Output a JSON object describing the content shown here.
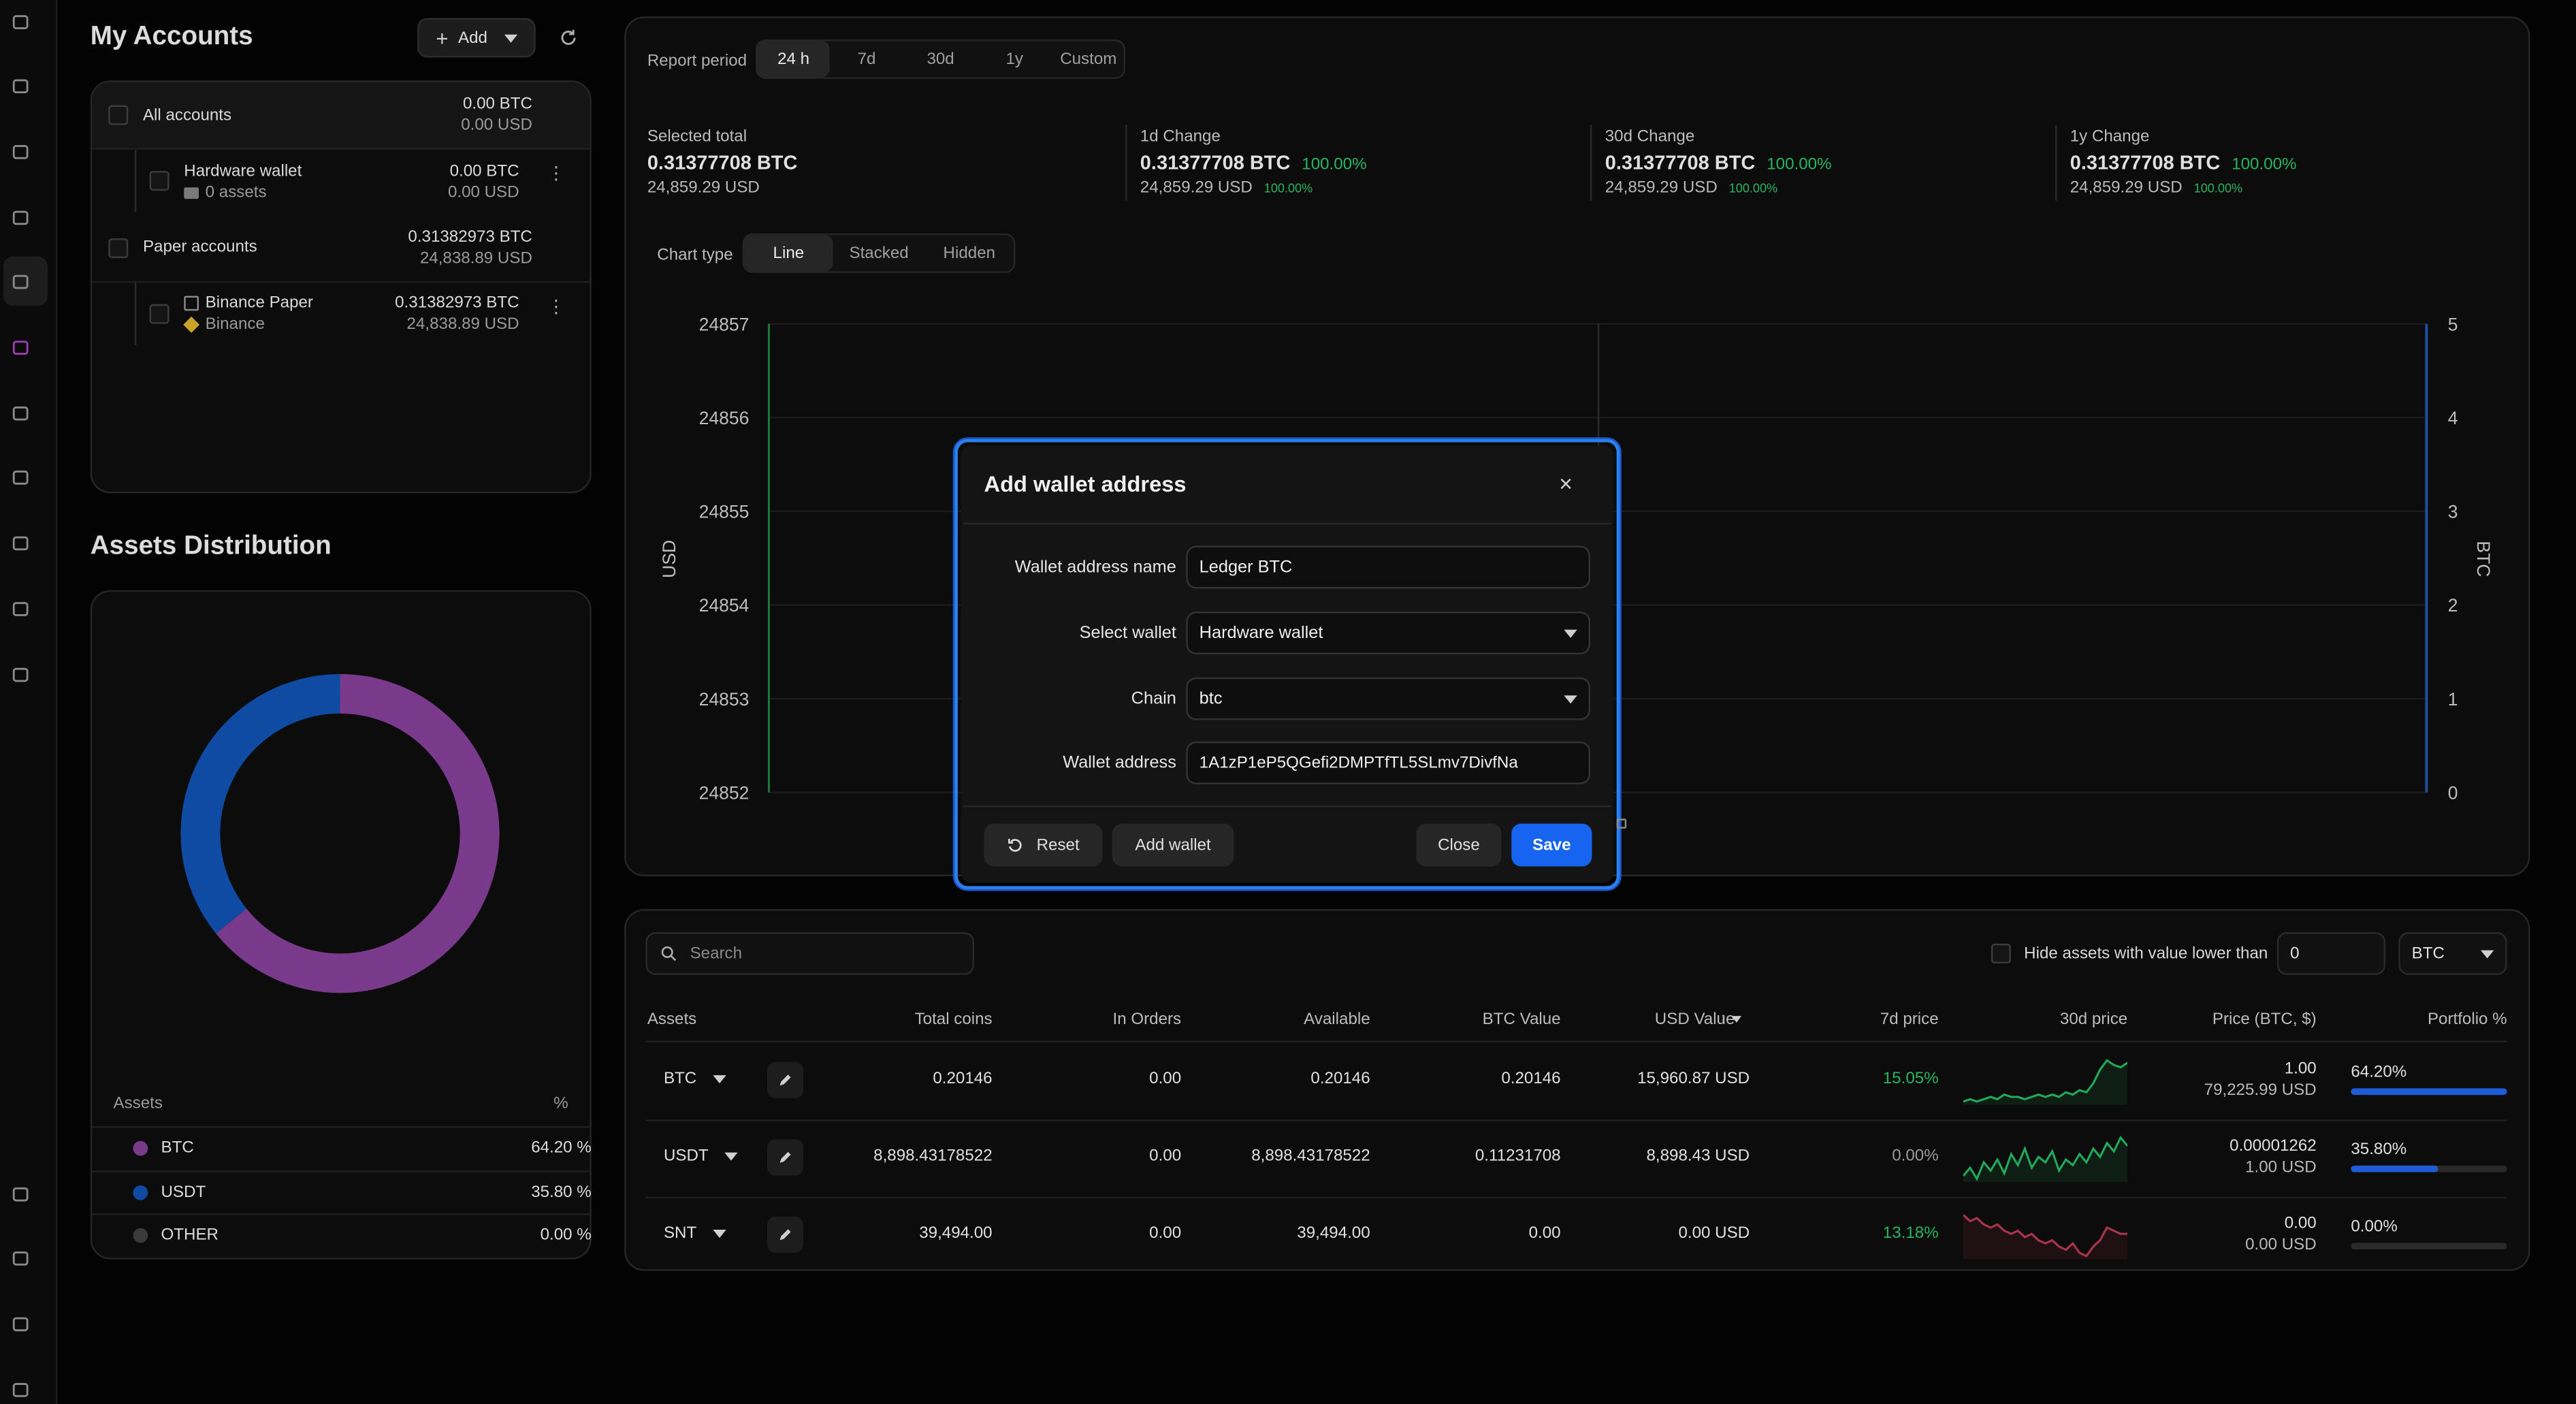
{
  "sidebar": {
    "icons": [
      "home-icon",
      "chart-icon",
      "grid-icon",
      "monitor-icon",
      "wallet-icon",
      "fingerprint-icon",
      "compass-icon",
      "barbell-icon",
      "percent-icon",
      "key-icon",
      "gear-icon",
      "chat-icon",
      "desktop-icon",
      "wifi-icon",
      "expand-icon"
    ]
  },
  "accounts": {
    "title": "My Accounts",
    "add_label": "Add",
    "all": {
      "label": "All accounts",
      "btc": "0.00 BTC",
      "usd": "0.00 USD"
    },
    "hardware": {
      "label": "Hardware wallet",
      "sub": "0 assets",
      "btc": "0.00 BTC",
      "usd": "0.00 USD"
    },
    "paper": {
      "label": "Paper accounts",
      "btc": "0.31382973 BTC",
      "usd": "24,838.89 USD"
    },
    "binance": {
      "label": "Binance Paper",
      "sub": "Binance",
      "btc": "0.31382973 BTC",
      "usd": "24,838.89 USD"
    }
  },
  "distribution": {
    "title": "Assets Distribution",
    "col_assets": "Assets",
    "col_pct": "%",
    "items": [
      {
        "name": "BTC",
        "pct": "64.20 %",
        "value": 64.2,
        "color": "#7a3a8c"
      },
      {
        "name": "USDT",
        "pct": "35.80 %",
        "value": 35.8,
        "color": "#0f4aa3"
      },
      {
        "name": "OTHER",
        "pct": "0.00 %",
        "value": 0,
        "color": "#3a3a3a"
      }
    ]
  },
  "report": {
    "period_label": "Report period",
    "periods": [
      "24 h",
      "7d",
      "30d",
      "1y",
      "Custom"
    ],
    "selected": {
      "label": "Selected total",
      "btc": "0.31377708 BTC",
      "usd": "24,859.29 USD"
    },
    "changes": [
      {
        "label": "1d Change",
        "btc": "0.31377708 BTC",
        "pct": "100.00%",
        "usd": "24,859.29 USD",
        "usd_pct": "100.00%"
      },
      {
        "label": "30d Change",
        "btc": "0.31377708 BTC",
        "pct": "100.00%",
        "usd": "24,859.29 USD",
        "usd_pct": "100.00%"
      },
      {
        "label": "1y Change",
        "btc": "0.31377708 BTC",
        "pct": "100.00%",
        "usd": "24,859.29 USD",
        "usd_pct": "100.00%"
      }
    ],
    "chart_type_label": "Chart type",
    "chart_types": [
      "Line",
      "Stacked",
      "Hidden"
    ]
  },
  "chart_data": {
    "type": "line",
    "ylabel": "USD",
    "y2label": "BTC",
    "ylim": [
      24852,
      24857
    ],
    "y2lim": [
      0,
      5
    ],
    "yticks": [
      "24857",
      "24856",
      "24855",
      "24854",
      "24853",
      "24852"
    ],
    "y2ticks": [
      "5",
      "4",
      "3",
      "2",
      "1",
      "0"
    ],
    "series": []
  },
  "table": {
    "search_placeholder": "Search",
    "hide_label": "Hide assets with value lower than",
    "hide_value": "0",
    "currency": "BTC",
    "headers": [
      "Assets",
      "Total coins",
      "In Orders",
      "Available",
      "BTC Value",
      "USD Value",
      "7d price",
      "30d price",
      "Price (BTC, $)",
      "Portfolio %"
    ],
    "rows": [
      {
        "asset": "BTC",
        "total": "0.20146",
        "orders": "0.00",
        "available": "0.20146",
        "btc": "0.20146",
        "usd": "15,960.87 USD",
        "d7": "15.05%",
        "price1": "1.00",
        "price2": "79,225.99 USD",
        "portfolio": "64.20%",
        "portfolio_value": 64.2,
        "spark": [
          4,
          5,
          4,
          5,
          6,
          5,
          7,
          6,
          6,
          5,
          6,
          7,
          6,
          7,
          6,
          8,
          7,
          9,
          8,
          12,
          18,
          22,
          20,
          19,
          21
        ],
        "spark_color": "#22a85a"
      },
      {
        "asset": "USDT",
        "total": "8,898.43178522",
        "orders": "0.00",
        "available": "8,898.43178522",
        "btc": "0.11231708",
        "usd": "8,898.43 USD",
        "d7": "0.00%",
        "price1": "0.00001262",
        "price2": "1.00 USD",
        "portfolio": "35.80%",
        "portfolio_value": 35.8,
        "spark": [
          6,
          9,
          5,
          11,
          8,
          12,
          7,
          14,
          10,
          16,
          9,
          13,
          11,
          15,
          8,
          12,
          10,
          14,
          11,
          16,
          13,
          18,
          15,
          20,
          17
        ],
        "spark_color": "#22a85a"
      },
      {
        "asset": "SNT",
        "total": "39,494.00",
        "orders": "0.00",
        "available": "39,494.00",
        "btc": "0.00",
        "usd": "0.00 USD",
        "d7": "13.18%",
        "price1": "0.00",
        "price2": "0.00 USD",
        "portfolio": "0.00%",
        "portfolio_value": 0,
        "spark": [
          18,
          16,
          17,
          15,
          14,
          15,
          13,
          12,
          13,
          11,
          12,
          10,
          9,
          10,
          8,
          7,
          9,
          6,
          5,
          8,
          10,
          14,
          13,
          12,
          12
        ],
        "spark_color": "#a8344e"
      }
    ]
  },
  "modal": {
    "title": "Add wallet address",
    "name_label": "Wallet address name",
    "name_value": "Ledger BTC",
    "wallet_label": "Select wallet",
    "wallet_value": "Hardware wallet",
    "chain_label": "Chain",
    "chain_value": "btc",
    "address_label": "Wallet address",
    "address_value": "1A1zP1eP5QGefi2DMPTfTL5SLmv7DivfNa",
    "reset": "Reset",
    "add_wallet": "Add wallet",
    "close": "Close",
    "save": "Save"
  }
}
